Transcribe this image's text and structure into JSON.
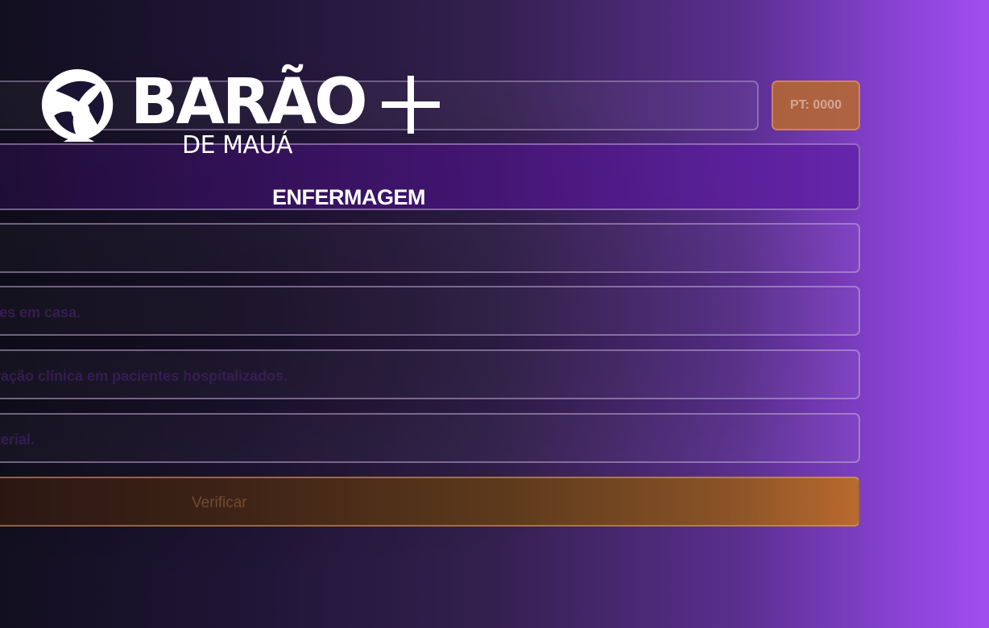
{
  "brand": {
    "logo_word": "BARÃO",
    "logo_sub": "DE MAUÁ",
    "logo_plus": "+"
  },
  "score": {
    "label": "PT: 0000"
  },
  "name_field": {
    "value": ""
  },
  "category": {
    "title": "ENFERMAGEM"
  },
  "options": [
    {
      "text": ""
    },
    {
      "text": "entes em casa."
    },
    {
      "text": "ioração clínica em pacientes hospitalizados."
    },
    {
      "text": "arterial."
    }
  ],
  "actions": {
    "verify_label": "Verificar"
  },
  "colors": {
    "accent_orange": "#b86a2e",
    "accent_purple": "#a24ff0"
  }
}
